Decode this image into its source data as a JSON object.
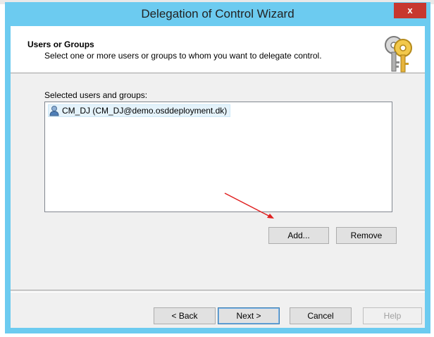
{
  "window": {
    "title": "Delegation of Control Wizard",
    "close_glyph": "x"
  },
  "header": {
    "title": "Users or Groups",
    "subtitle": "Select one or more users or groups to whom you want to delegate control."
  },
  "list": {
    "label": "Selected users and groups:",
    "items": [
      {
        "icon": "user-icon",
        "text": "CM_DJ (CM_DJ@demo.osddeployment.dk)"
      }
    ]
  },
  "list_buttons": {
    "add": "Add...",
    "remove": "Remove"
  },
  "footer_buttons": {
    "back": "< Back",
    "next": "Next >",
    "cancel": "Cancel",
    "help": "Help"
  },
  "colors": {
    "title_bar": "#6ccbf0",
    "close_button": "#c7372f",
    "annotation_arrow": "#e02020"
  },
  "icons": [
    "keys-icon",
    "user-icon",
    "close-icon",
    "arrow-annotation"
  ]
}
